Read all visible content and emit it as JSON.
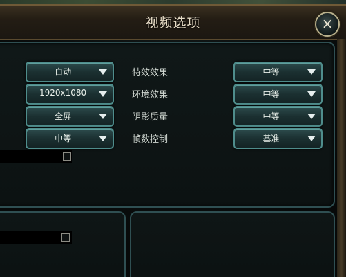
{
  "window": {
    "title": "视频选项",
    "close_glyph": "×"
  },
  "left_column": {
    "dropdowns": [
      {
        "value": "自动"
      },
      {
        "value": "1920x1080"
      },
      {
        "value": "全屏"
      },
      {
        "value": "中等"
      }
    ]
  },
  "right_column": {
    "rows": [
      {
        "label": "特效效果",
        "value": "中等"
      },
      {
        "label": "环境效果",
        "value": "中等"
      },
      {
        "label": "阴影质量",
        "value": "中等"
      },
      {
        "label": "帧数控制",
        "value": "基准"
      }
    ]
  },
  "colors": {
    "accent_teal": "#4f8d8c",
    "title_gold": "#6f5a37",
    "text_light": "#e8efe9"
  },
  "icons": {
    "dropdown_arrow": "chevron-down-icon",
    "close": "close-icon"
  }
}
